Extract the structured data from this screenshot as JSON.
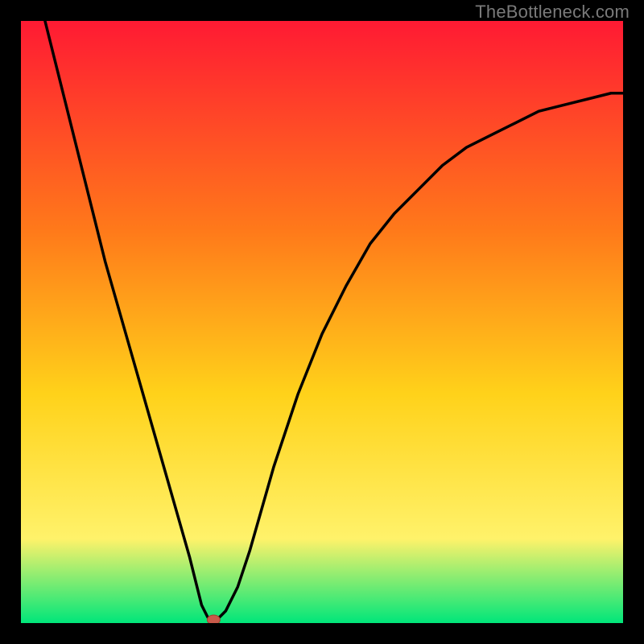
{
  "watermark": "TheBottleneck.com",
  "colors": {
    "frame": "#000000",
    "gradient_top": "#ff1a33",
    "gradient_mid1": "#ff7a1a",
    "gradient_mid2": "#ffd21a",
    "gradient_mid3": "#fff26a",
    "gradient_bottom": "#00e67a",
    "curve": "#000000",
    "marker_fill": "#c85a4a",
    "marker_stroke": "#a33e2c"
  },
  "chart_data": {
    "type": "line",
    "title": "",
    "xlabel": "",
    "ylabel": "",
    "xlim": [
      0,
      100
    ],
    "ylim": [
      0,
      100
    ],
    "x": [
      4,
      6,
      8,
      10,
      12,
      14,
      16,
      18,
      20,
      22,
      24,
      26,
      28,
      29,
      30,
      31,
      32,
      33,
      34,
      36,
      38,
      40,
      42,
      44,
      46,
      48,
      50,
      54,
      58,
      62,
      66,
      70,
      74,
      78,
      82,
      86,
      90,
      94,
      98,
      100
    ],
    "values": [
      100,
      92,
      84,
      76,
      68,
      60,
      53,
      46,
      39,
      32,
      25,
      18,
      11,
      7,
      3,
      1,
      0,
      1,
      2,
      6,
      12,
      19,
      26,
      32,
      38,
      43,
      48,
      56,
      63,
      68,
      72,
      76,
      79,
      81,
      83,
      85,
      86,
      87,
      88,
      88
    ],
    "marker": {
      "x": 32,
      "y": 0
    },
    "grid": false,
    "legend": null
  }
}
